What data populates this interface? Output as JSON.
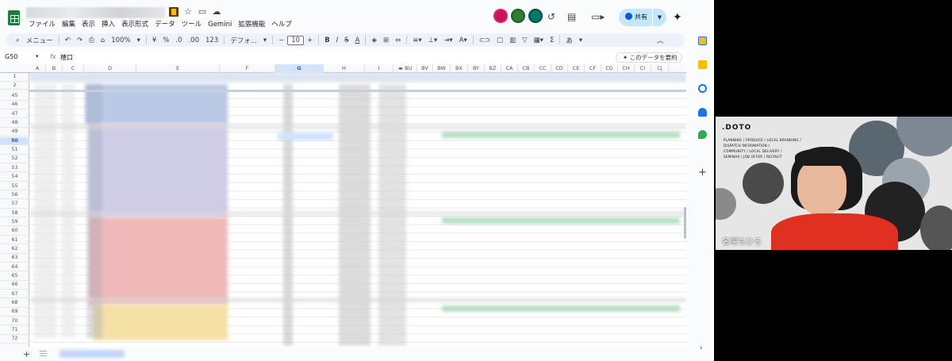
{
  "app": {
    "menu": [
      "ファイル",
      "編集",
      "表示",
      "挿入",
      "表示形式",
      "データ",
      "ツール",
      "Gemini",
      "拡張機能",
      "ヘルプ"
    ],
    "share_label": "共有"
  },
  "toolbar": {
    "menu_search": "メニュー",
    "zoom": "100%",
    "currency": "¥",
    "percent": "%",
    "decimal_dec": ".0",
    "decimal_inc": ".00",
    "number_format": "123",
    "font": "デフォ...",
    "font_size": "10",
    "bold": "B",
    "italic": "I",
    "strike": "S",
    "text_color": "A",
    "sigma": "Σ",
    "input_tools": "あ"
  },
  "formula_bar": {
    "name_box": "G50",
    "fx": "fx",
    "value": "穂口",
    "summarize_button": "このデータを要約"
  },
  "grid": {
    "columns": [
      "A",
      "B",
      "C",
      "D",
      "E",
      "F",
      "G",
      "H",
      "I",
      "BU",
      "BV",
      "BW",
      "BX",
      "BY",
      "BZ",
      "CA",
      "CB",
      "CC",
      "CD",
      "CE",
      "CF",
      "CG",
      "CH",
      "CI",
      "CJ"
    ],
    "selected_column": "G",
    "rows": [
      "1",
      "2",
      "45",
      "46",
      "47",
      "48",
      "49",
      "50",
      "51",
      "52",
      "53",
      "54",
      "55",
      "56",
      "57",
      "58",
      "59",
      "60",
      "61",
      "62",
      "63",
      "64",
      "65",
      "66",
      "67",
      "68",
      "69",
      "70",
      "71",
      "72"
    ],
    "selected_row": "50"
  },
  "video": {
    "logo": ".DOTO",
    "tagline": [
      "PLANNING / PRODUCE / LOCAL BRANDING /",
      "DISPATCH INFORMATION /",
      "COMMUNITY / LOCAL DELIVERY /",
      "SEMINAR / JOB OFFER / RECRUIT"
    ],
    "participant_name": "名塚ちひろ"
  },
  "colors": {
    "accent": "#0b57d0",
    "share_bg": "#c2e7ff",
    "sheet_green": "#188038"
  }
}
